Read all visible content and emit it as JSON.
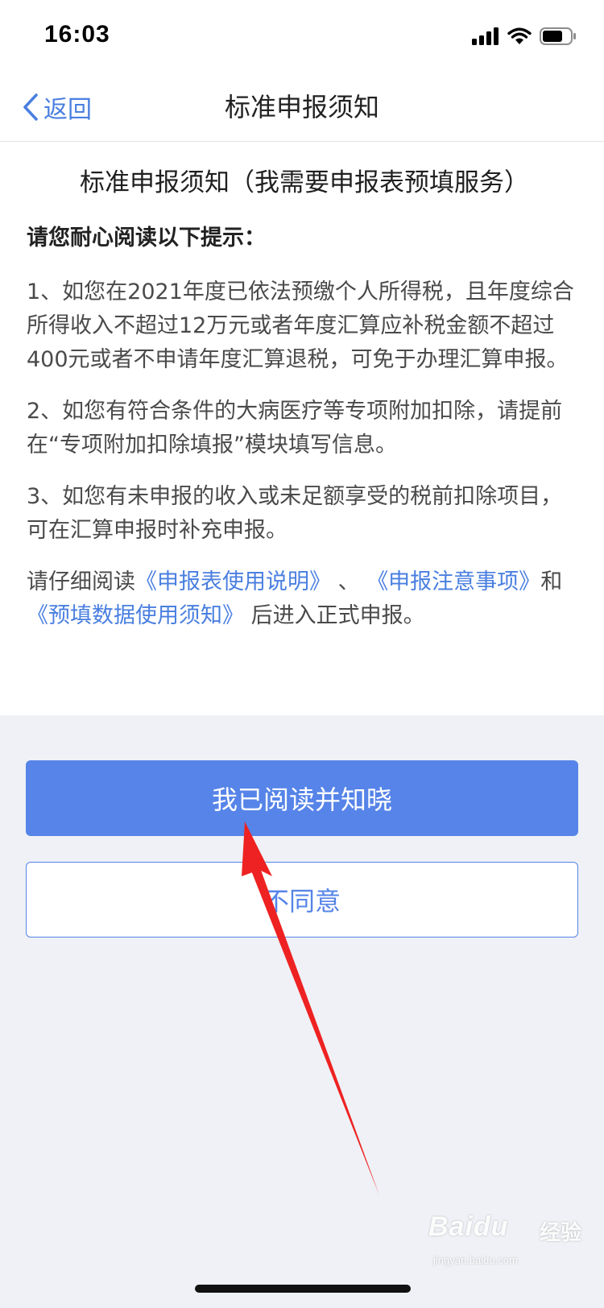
{
  "status_bar": {
    "time": "16:03"
  },
  "nav": {
    "back_label": "返回",
    "title": "标准申报须知"
  },
  "content": {
    "doc_title": "标准申报须知（我需要申报表预填服务）",
    "lead": "请您耐心阅读以下提示：",
    "items": [
      "1、如您在2021年度已依法预缴个人所得税，且年度综合所得收入不超过12万元或者年度汇算应补税金额不超过400元或者不申请年度汇算退税，可免于办理汇算申报。",
      "2、如您有符合条件的大病医疗等专项附加扣除，请提前在“专项附加扣除填报”模块填写信息。",
      "3、如您有未申报的收入或未足额享受的税前扣除项目，可在汇算申报时补充申报。"
    ],
    "read_notice": {
      "prefix": "请仔细阅读",
      "link1": "《申报表使用说明》",
      "sep1": "、",
      "link2": "《申报注意事项》",
      "sep2": "和",
      "link3": "《预填数据使用须知》",
      "suffix": "后进入正式申报。"
    }
  },
  "buttons": {
    "agree": "我已阅读并知晓",
    "disagree": "不同意"
  },
  "watermark": {
    "brand": "Baidu",
    "sub": "经验",
    "url": "jingyan.baidu.com"
  },
  "colors": {
    "accent": "#5684e8",
    "link": "#4a7fe0",
    "annotation_arrow": "#ee2222"
  },
  "icons": [
    "back-chevron-icon",
    "cellular-signal-icon",
    "wifi-icon",
    "battery-icon",
    "annotation-arrow-icon"
  ]
}
